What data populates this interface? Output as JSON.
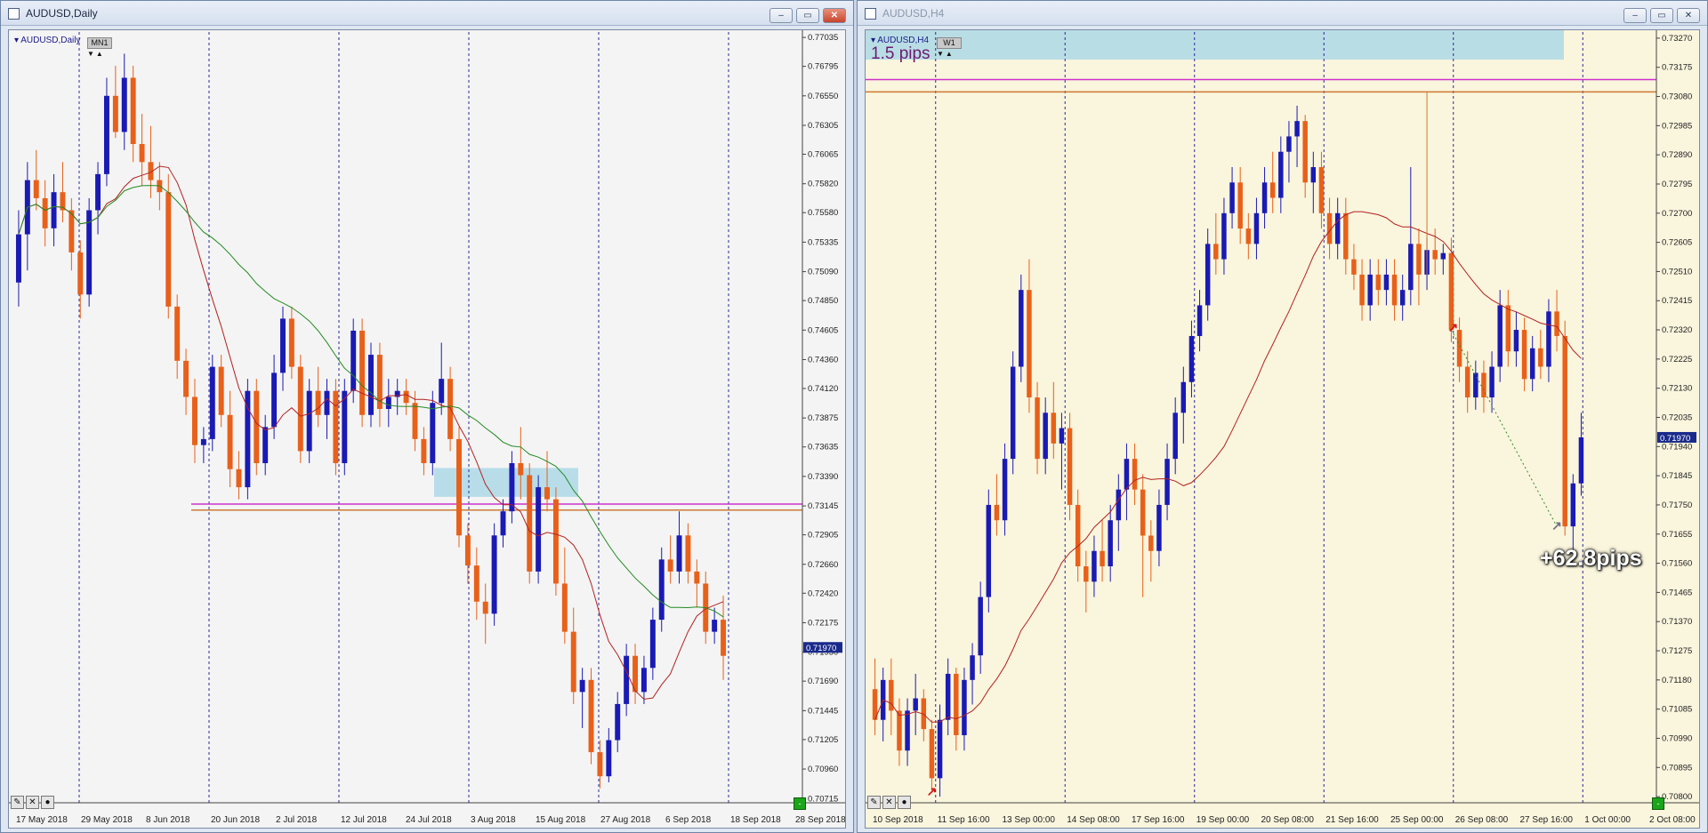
{
  "daily": {
    "title": "AUDUSD,Daily",
    "symbol_label": "AUDUSD,Daily",
    "timeframe_badge": "MN1",
    "price_tag": "0.71970",
    "buttons": {
      "minimize": "–",
      "restore": "▭",
      "close": "✕"
    },
    "toolbox_icons": [
      "draw-icon",
      "close-icon",
      "circle-icon"
    ],
    "chart_data": {
      "type": "candlestick",
      "symbol": "AUDUSD",
      "timeframe": "Daily",
      "y_ticks": [
        "0.77035",
        "0.76795",
        "0.76550",
        "0.76305",
        "0.76065",
        "0.75820",
        "0.75580",
        "0.75335",
        "0.75090",
        "0.74850",
        "0.74605",
        "0.74360",
        "0.74120",
        "0.73875",
        "0.73635",
        "0.73390",
        "0.73145",
        "0.72905",
        "0.72660",
        "0.72420",
        "0.72175",
        "0.71930",
        "0.71690",
        "0.71445",
        "0.71205",
        "0.70960",
        "0.70715"
      ],
      "ylim": [
        0.7068,
        0.7708
      ],
      "x_ticks": [
        "17 May 2018",
        "29 May 2018",
        "8 Jun 2018",
        "20 Jun 2018",
        "2 Jul 2018",
        "12 Jul 2018",
        "24 Jul 2018",
        "3 Aug 2018",
        "15 Aug 2018",
        "27 Aug 2018",
        "6 Sep 2018",
        "18 Sep 2018",
        "28 Sep 2018"
      ],
      "current_price": 0.7197,
      "zone": {
        "from": 0.7322,
        "to": 0.7346,
        "color": "#add8e6"
      },
      "hlines": [
        {
          "price": 0.7316,
          "color": "#cc33cc"
        },
        {
          "price": 0.7311,
          "color": "#cc7a33"
        }
      ],
      "ma_fast_color": "#b22222",
      "ma_slow_color": "#228b22",
      "bull_color": "#1a1ab4",
      "bear_color": "#e8601a",
      "candles": [
        [
          0.75,
          0.756,
          0.748,
          0.754
        ],
        [
          0.754,
          0.76,
          0.751,
          0.7585
        ],
        [
          0.7585,
          0.761,
          0.756,
          0.757
        ],
        [
          0.757,
          0.7585,
          0.753,
          0.7545
        ],
        [
          0.7545,
          0.759,
          0.753,
          0.7575
        ],
        [
          0.7575,
          0.76,
          0.755,
          0.756
        ],
        [
          0.756,
          0.757,
          0.751,
          0.7525
        ],
        [
          0.7525,
          0.7535,
          0.747,
          0.749
        ],
        [
          0.749,
          0.757,
          0.748,
          0.756
        ],
        [
          0.756,
          0.76,
          0.754,
          0.759
        ],
        [
          0.759,
          0.767,
          0.758,
          0.7655
        ],
        [
          0.7655,
          0.768,
          0.762,
          0.7625
        ],
        [
          0.7625,
          0.769,
          0.761,
          0.767
        ],
        [
          0.767,
          0.768,
          0.76,
          0.7615
        ],
        [
          0.7615,
          0.764,
          0.758,
          0.76
        ],
        [
          0.76,
          0.763,
          0.757,
          0.7585
        ],
        [
          0.7585,
          0.76,
          0.756,
          0.7575
        ],
        [
          0.7575,
          0.759,
          0.747,
          0.748
        ],
        [
          0.748,
          0.749,
          0.742,
          0.7435
        ],
        [
          0.7435,
          0.7445,
          0.739,
          0.7405
        ],
        [
          0.7405,
          0.742,
          0.735,
          0.7365
        ],
        [
          0.7365,
          0.738,
          0.735,
          0.737
        ],
        [
          0.737,
          0.744,
          0.736,
          0.743
        ],
        [
          0.743,
          0.744,
          0.738,
          0.739
        ],
        [
          0.739,
          0.741,
          0.733,
          0.7345
        ],
        [
          0.7345,
          0.736,
          0.732,
          0.733
        ],
        [
          0.733,
          0.742,
          0.732,
          0.741
        ],
        [
          0.741,
          0.742,
          0.734,
          0.735
        ],
        [
          0.735,
          0.739,
          0.734,
          0.738
        ],
        [
          0.738,
          0.744,
          0.737,
          0.7425
        ],
        [
          0.7425,
          0.748,
          0.741,
          0.747
        ],
        [
          0.747,
          0.748,
          0.742,
          0.743
        ],
        [
          0.743,
          0.744,
          0.735,
          0.736
        ],
        [
          0.736,
          0.742,
          0.735,
          0.741
        ],
        [
          0.741,
          0.743,
          0.738,
          0.739
        ],
        [
          0.739,
          0.742,
          0.737,
          0.741
        ],
        [
          0.741,
          0.742,
          0.734,
          0.735
        ],
        [
          0.735,
          0.742,
          0.734,
          0.741
        ],
        [
          0.741,
          0.747,
          0.74,
          0.746
        ],
        [
          0.746,
          0.747,
          0.738,
          0.739
        ],
        [
          0.739,
          0.745,
          0.738,
          0.744
        ],
        [
          0.744,
          0.745,
          0.738,
          0.7395
        ],
        [
          0.7395,
          0.742,
          0.738,
          0.7405
        ],
        [
          0.7405,
          0.742,
          0.739,
          0.741
        ],
        [
          0.741,
          0.742,
          0.739,
          0.74
        ],
        [
          0.74,
          0.741,
          0.736,
          0.737
        ],
        [
          0.737,
          0.738,
          0.734,
          0.735
        ],
        [
          0.735,
          0.741,
          0.734,
          0.74
        ],
        [
          0.74,
          0.745,
          0.739,
          0.742
        ],
        [
          0.742,
          0.743,
          0.736,
          0.737
        ],
        [
          0.737,
          0.738,
          0.728,
          0.729
        ],
        [
          0.729,
          0.73,
          0.725,
          0.7265
        ],
        [
          0.7265,
          0.728,
          0.722,
          0.7235
        ],
        [
          0.7235,
          0.725,
          0.72,
          0.7225
        ],
        [
          0.7225,
          0.73,
          0.7215,
          0.729
        ],
        [
          0.729,
          0.732,
          0.728,
          0.731
        ],
        [
          0.731,
          0.736,
          0.73,
          0.735
        ],
        [
          0.735,
          0.738,
          0.732,
          0.734
        ],
        [
          0.734,
          0.735,
          0.725,
          0.726
        ],
        [
          0.726,
          0.734,
          0.725,
          0.733
        ],
        [
          0.733,
          0.736,
          0.731,
          0.732
        ],
        [
          0.732,
          0.733,
          0.724,
          0.725
        ],
        [
          0.725,
          0.728,
          0.72,
          0.721
        ],
        [
          0.721,
          0.723,
          0.715,
          0.716
        ],
        [
          0.716,
          0.718,
          0.713,
          0.717
        ],
        [
          0.717,
          0.718,
          0.71,
          0.711
        ],
        [
          0.711,
          0.712,
          0.708,
          0.709
        ],
        [
          0.709,
          0.713,
          0.7085,
          0.712
        ],
        [
          0.712,
          0.716,
          0.711,
          0.715
        ],
        [
          0.715,
          0.72,
          0.714,
          0.719
        ],
        [
          0.719,
          0.72,
          0.715,
          0.716
        ],
        [
          0.716,
          0.719,
          0.715,
          0.718
        ],
        [
          0.718,
          0.723,
          0.717,
          0.722
        ],
        [
          0.722,
          0.728,
          0.721,
          0.727
        ],
        [
          0.727,
          0.729,
          0.725,
          0.726
        ],
        [
          0.726,
          0.731,
          0.725,
          0.729
        ],
        [
          0.729,
          0.73,
          0.725,
          0.726
        ],
        [
          0.726,
          0.727,
          0.723,
          0.725
        ],
        [
          0.725,
          0.726,
          0.72,
          0.721
        ],
        [
          0.721,
          0.723,
          0.72,
          0.722
        ],
        [
          0.722,
          0.724,
          0.717,
          0.719
        ]
      ]
    }
  },
  "h4": {
    "title": "AUDUSD,H4",
    "symbol_label": "AUDUSD,H4",
    "timeframe_badge": "W1",
    "pips_label": "1.5 pips",
    "result_label": "+62.8pips",
    "price_tag": "0.71970",
    "buttons": {
      "minimize": "–",
      "restore": "▭",
      "close": "✕"
    },
    "toolbox_icons": [
      "draw-icon",
      "close-icon",
      "circle-icon"
    ],
    "chart_data": {
      "type": "candlestick",
      "symbol": "AUDUSD",
      "timeframe": "H4",
      "y_ticks": [
        "0.73270",
        "0.73175",
        "0.73080",
        "0.72985",
        "0.72890",
        "0.72795",
        "0.72700",
        "0.72605",
        "0.72510",
        "0.72415",
        "0.72320",
        "0.72225",
        "0.72130",
        "0.72035",
        "0.71940",
        "0.71845",
        "0.71750",
        "0.71655",
        "0.71560",
        "0.71465",
        "0.71370",
        "0.71275",
        "0.71180",
        "0.71085",
        "0.70990",
        "0.70895",
        "0.70800"
      ],
      "ylim": [
        0.7078,
        0.7329
      ],
      "x_ticks": [
        "10 Sep 2018",
        "11 Sep 16:00",
        "13 Sep 00:00",
        "14 Sep 08:00",
        "17 Sep 16:00",
        "19 Sep 00:00",
        "20 Sep 08:00",
        "21 Sep 16:00",
        "25 Sep 00:00",
        "26 Sep 08:00",
        "27 Sep 16:00",
        "1 Oct 00:00",
        "2 Oct 08:00"
      ],
      "current_price": 0.7197,
      "zone": {
        "from": 0.732,
        "to": 0.733,
        "color": "#add8e6"
      },
      "hlines": [
        {
          "price": 0.73135,
          "color": "#cc33cc"
        },
        {
          "price": 0.73095,
          "color": "#cc7a33"
        }
      ],
      "ma_color": "#b22222",
      "bull_color": "#1a1ab4",
      "bear_color": "#e8601a",
      "candles": [
        [
          0.7115,
          0.7125,
          0.71,
          0.7105
        ],
        [
          0.7105,
          0.7122,
          0.7098,
          0.7118
        ],
        [
          0.7118,
          0.7125,
          0.71,
          0.7108
        ],
        [
          0.7108,
          0.7112,
          0.709,
          0.7095
        ],
        [
          0.7095,
          0.7112,
          0.709,
          0.7108
        ],
        [
          0.7108,
          0.712,
          0.71,
          0.7112
        ],
        [
          0.7112,
          0.7115,
          0.7098,
          0.7102
        ],
        [
          0.7102,
          0.7105,
          0.7082,
          0.7086
        ],
        [
          0.7086,
          0.711,
          0.708,
          0.7105
        ],
        [
          0.7105,
          0.7125,
          0.71,
          0.712
        ],
        [
          0.712,
          0.7122,
          0.7095,
          0.71
        ],
        [
          0.71,
          0.7122,
          0.7095,
          0.7118
        ],
        [
          0.7118,
          0.713,
          0.711,
          0.7126
        ],
        [
          0.7126,
          0.715,
          0.712,
          0.7145
        ],
        [
          0.7145,
          0.718,
          0.714,
          0.7175
        ],
        [
          0.7175,
          0.7185,
          0.7165,
          0.717
        ],
        [
          0.717,
          0.7195,
          0.7165,
          0.719
        ],
        [
          0.719,
          0.7225,
          0.7185,
          0.722
        ],
        [
          0.722,
          0.725,
          0.7215,
          0.7245
        ],
        [
          0.7245,
          0.7255,
          0.7205,
          0.721
        ],
        [
          0.721,
          0.7215,
          0.7185,
          0.719
        ],
        [
          0.719,
          0.721,
          0.7185,
          0.7205
        ],
        [
          0.7205,
          0.7215,
          0.719,
          0.7195
        ],
        [
          0.7195,
          0.7205,
          0.718,
          0.72
        ],
        [
          0.72,
          0.7205,
          0.717,
          0.7175
        ],
        [
          0.7175,
          0.718,
          0.715,
          0.7155
        ],
        [
          0.7155,
          0.716,
          0.714,
          0.715
        ],
        [
          0.715,
          0.7165,
          0.7145,
          0.716
        ],
        [
          0.716,
          0.717,
          0.715,
          0.7155
        ],
        [
          0.7155,
          0.7175,
          0.715,
          0.717
        ],
        [
          0.717,
          0.7185,
          0.716,
          0.718
        ],
        [
          0.718,
          0.7195,
          0.717,
          0.719
        ],
        [
          0.719,
          0.7195,
          0.7175,
          0.718
        ],
        [
          0.718,
          0.7185,
          0.7145,
          0.7165
        ],
        [
          0.7165,
          0.717,
          0.715,
          0.716
        ],
        [
          0.716,
          0.718,
          0.7155,
          0.7175
        ],
        [
          0.7175,
          0.7195,
          0.717,
          0.719
        ],
        [
          0.719,
          0.721,
          0.7185,
          0.7205
        ],
        [
          0.7205,
          0.722,
          0.7195,
          0.7215
        ],
        [
          0.7215,
          0.7235,
          0.721,
          0.723
        ],
        [
          0.723,
          0.7245,
          0.7225,
          0.724
        ],
        [
          0.724,
          0.7265,
          0.7235,
          0.726
        ],
        [
          0.726,
          0.727,
          0.725,
          0.7255
        ],
        [
          0.7255,
          0.7275,
          0.725,
          0.727
        ],
        [
          0.727,
          0.7285,
          0.7265,
          0.728
        ],
        [
          0.728,
          0.7285,
          0.726,
          0.7265
        ],
        [
          0.7265,
          0.727,
          0.7255,
          0.726
        ],
        [
          0.726,
          0.7275,
          0.7255,
          0.727
        ],
        [
          0.727,
          0.7285,
          0.7265,
          0.728
        ],
        [
          0.728,
          0.729,
          0.727,
          0.7275
        ],
        [
          0.7275,
          0.7295,
          0.727,
          0.729
        ],
        [
          0.729,
          0.73,
          0.728,
          0.7295
        ],
        [
          0.7295,
          0.7305,
          0.7285,
          0.73
        ],
        [
          0.73,
          0.7302,
          0.7275,
          0.728
        ],
        [
          0.728,
          0.729,
          0.727,
          0.7285
        ],
        [
          0.7285,
          0.729,
          0.7265,
          0.727
        ],
        [
          0.727,
          0.7275,
          0.7255,
          0.726
        ],
        [
          0.726,
          0.7275,
          0.7255,
          0.727
        ],
        [
          0.727,
          0.7275,
          0.725,
          0.7255
        ],
        [
          0.7255,
          0.726,
          0.7245,
          0.725
        ],
        [
          0.725,
          0.7255,
          0.7235,
          0.724
        ],
        [
          0.724,
          0.7255,
          0.7235,
          0.725
        ],
        [
          0.725,
          0.7255,
          0.724,
          0.7245
        ],
        [
          0.7245,
          0.7255,
          0.724,
          0.725
        ],
        [
          0.725,
          0.7255,
          0.7235,
          0.724
        ],
        [
          0.724,
          0.725,
          0.7235,
          0.7245
        ],
        [
          0.7245,
          0.7285,
          0.724,
          0.726
        ],
        [
          0.726,
          0.7265,
          0.724,
          0.725
        ],
        [
          0.725,
          0.7262,
          0.7245,
          0.7258
        ],
        [
          0.7258,
          0.7265,
          0.725,
          0.7255
        ],
        [
          0.7255,
          0.726,
          0.725,
          0.7257
        ],
        [
          0.7257,
          0.7262,
          0.7228,
          0.7232
        ],
        [
          0.7232,
          0.7236,
          0.7215,
          0.722
        ],
        [
          0.722,
          0.7225,
          0.7205,
          0.721
        ],
        [
          0.721,
          0.7222,
          0.7206,
          0.7218
        ],
        [
          0.7218,
          0.7222,
          0.7205,
          0.721
        ],
        [
          0.721,
          0.7225,
          0.7205,
          0.722
        ],
        [
          0.722,
          0.7245,
          0.7215,
          0.724
        ],
        [
          0.724,
          0.7245,
          0.722,
          0.7225
        ],
        [
          0.7225,
          0.7238,
          0.722,
          0.7232
        ],
        [
          0.7232,
          0.7236,
          0.7212,
          0.7216
        ],
        [
          0.7216,
          0.723,
          0.7212,
          0.7226
        ],
        [
          0.7226,
          0.7232,
          0.7216,
          0.722
        ],
        [
          0.722,
          0.7242,
          0.7215,
          0.7238
        ],
        [
          0.7238,
          0.7245,
          0.7225,
          0.723
        ],
        [
          0.723,
          0.7235,
          0.7165,
          0.7168
        ],
        [
          0.7168,
          0.7185,
          0.716,
          0.7182
        ],
        [
          0.7182,
          0.7205,
          0.7178,
          0.7197
        ]
      ]
    }
  }
}
